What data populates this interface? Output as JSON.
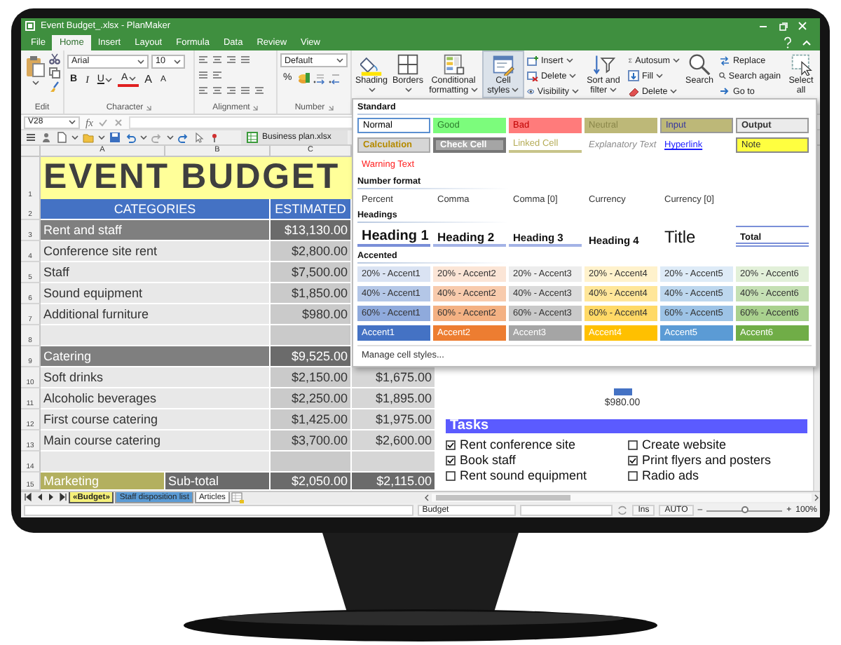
{
  "window": {
    "title": "Event Budget_.xlsx - PlanMaker"
  },
  "menu_tabs": [
    {
      "label": "File",
      "selected": false
    },
    {
      "label": "Home",
      "selected": true
    },
    {
      "label": "Insert",
      "selected": false
    },
    {
      "label": "Layout",
      "selected": false
    },
    {
      "label": "Formula",
      "selected": false
    },
    {
      "label": "Data",
      "selected": false
    },
    {
      "label": "Review",
      "selected": false
    },
    {
      "label": "View",
      "selected": false
    }
  ],
  "ribbon": {
    "font_name": "Arial",
    "font_size": "10",
    "char_buttons": [
      "B",
      "I",
      "U",
      "A",
      "A",
      "A"
    ],
    "number_format": "Default",
    "number_buttons": [
      "%"
    ],
    "group_labels": [
      "Edit",
      "Character",
      "Alignment",
      "Number"
    ],
    "tools": [
      {
        "kind": "large",
        "label": "Shading",
        "selected": false,
        "caret": true
      },
      {
        "kind": "large",
        "label": "Borders",
        "selected": false,
        "caret": true
      },
      {
        "kind": "large",
        "label": "Conditional formatting",
        "selected": false,
        "caret": true
      },
      {
        "kind": "large",
        "label": "Cell styles",
        "selected": true,
        "caret": true
      },
      {
        "kind": "stack",
        "items": [
          {
            "label": "Insert",
            "caret": true
          },
          {
            "label": "Delete",
            "caret": true
          },
          {
            "label": "Visibility",
            "caret": true
          }
        ]
      },
      {
        "kind": "large",
        "label": "Sort and filter",
        "selected": false,
        "caret": true
      },
      {
        "kind": "stack",
        "items": [
          {
            "label": "Autosum",
            "caret": true
          },
          {
            "label": "Fill",
            "caret": true
          },
          {
            "label": "Delete",
            "caret": true
          }
        ]
      },
      {
        "kind": "large",
        "label": "Search",
        "selected": false,
        "caret": false
      },
      {
        "kind": "stack",
        "items": [
          {
            "label": "Replace",
            "caret": false
          },
          {
            "label": "Search again",
            "caret": false
          },
          {
            "label": "Go to",
            "caret": false
          }
        ]
      },
      {
        "kind": "large",
        "label": "Select all",
        "selected": false,
        "caret": false
      }
    ]
  },
  "formula_bar": {
    "cell_ref": "V28",
    "function_label": "fx"
  },
  "document_tab": {
    "label": "Business plan.xlsx"
  },
  "columns": [
    "A",
    "B",
    "C"
  ],
  "rows": [
    {
      "number": "1",
      "kind": "title",
      "cells": [
        "EVENT BUDGET"
      ]
    },
    {
      "number": "2",
      "kind": "header",
      "cells": [
        "CATEGORIES",
        "ESTIMATED"
      ]
    },
    {
      "number": "3",
      "kind": "section",
      "cells": [
        "Rent and staff",
        "$13,130.00"
      ]
    },
    {
      "number": "4",
      "kind": "item",
      "cells": [
        "Conference site rent",
        "$2,800.00"
      ]
    },
    {
      "number": "5",
      "kind": "item",
      "cells": [
        "Staff",
        "$7,500.00"
      ]
    },
    {
      "number": "6",
      "kind": "item",
      "cells": [
        "Sound equipment",
        "$1,850.00"
      ]
    },
    {
      "number": "7",
      "kind": "item",
      "cells": [
        "Additional furniture",
        "$980.00"
      ]
    },
    {
      "number": "8",
      "kind": "blank",
      "cells": []
    },
    {
      "number": "9",
      "kind": "section",
      "cells": [
        "Catering",
        "$9,525.00"
      ]
    },
    {
      "number": "10",
      "kind": "item",
      "cells": [
        "Soft drinks",
        "$2,150.00",
        "$1,675.00"
      ]
    },
    {
      "number": "11",
      "kind": "item",
      "cells": [
        "Alcoholic beverages",
        "$2,250.00",
        "$1,895.00"
      ]
    },
    {
      "number": "12",
      "kind": "item",
      "cells": [
        "First course catering",
        "$1,425.00",
        "$1,975.00"
      ]
    },
    {
      "number": "13",
      "kind": "item",
      "cells": [
        "Main course catering",
        "$3,700.00",
        "$2,600.00"
      ]
    },
    {
      "number": "14",
      "kind": "blank",
      "cells": []
    },
    {
      "number": "15",
      "kind": "subtotal",
      "cells": [
        "Marketing",
        "Sub-total",
        "$2,050.00",
        "$2,115.00"
      ]
    }
  ],
  "styles_menu": {
    "sections": [
      {
        "label": "Standard",
        "items": [
          {
            "label": "Normal",
            "kind": "normal"
          },
          {
            "label": "Good",
            "kind": "good"
          },
          {
            "label": "Bad",
            "kind": "bad"
          },
          {
            "label": "Neutral",
            "kind": "neutral"
          },
          {
            "label": "Input",
            "kind": "input"
          },
          {
            "label": "Output",
            "kind": "output"
          },
          {
            "label": "Calculation",
            "kind": "calculation"
          },
          {
            "label": "Check Cell",
            "kind": "check"
          },
          {
            "label": "Linked Cell",
            "kind": "linked"
          },
          {
            "label": "Explanatory Text",
            "kind": "explanatory"
          },
          {
            "label": "Hyperlink",
            "kind": "hyperlink"
          },
          {
            "label": "Note",
            "kind": "note"
          },
          {
            "label": "Warning Text",
            "kind": "warning"
          }
        ]
      },
      {
        "label": "Number format",
        "items": [
          {
            "label": "Percent",
            "kind": "plain"
          },
          {
            "label": "Comma",
            "kind": "plain"
          },
          {
            "label": "Comma [0]",
            "kind": "plain"
          },
          {
            "label": "Currency",
            "kind": "plain"
          },
          {
            "label": "Currency [0]",
            "kind": "plain"
          }
        ]
      },
      {
        "label": "Headings",
        "items": [
          {
            "label": "Heading 1",
            "kind": "heading1"
          },
          {
            "label": "Heading 2",
            "kind": "heading2"
          },
          {
            "label": "Heading 3",
            "kind": "heading3"
          },
          {
            "label": "Heading 4",
            "kind": "heading4"
          },
          {
            "label": "Title",
            "kind": "title"
          },
          {
            "label": "Total",
            "kind": "total"
          }
        ]
      },
      {
        "label": "Accented",
        "items": [
          {
            "label": "20% - Accent1",
            "kind": "tint",
            "color": "#dae3f3"
          },
          {
            "label": "20% - Accent2",
            "kind": "tint",
            "color": "#fbe5d6"
          },
          {
            "label": "20% - Accent3",
            "kind": "tint",
            "color": "#ededed"
          },
          {
            "label": "20% - Accent4",
            "kind": "tint",
            "color": "#fff2cc"
          },
          {
            "label": "20% - Accent5",
            "kind": "tint",
            "color": "#deebf7"
          },
          {
            "label": "20% - Accent6",
            "kind": "tint",
            "color": "#e2f0d9"
          },
          {
            "label": "40% - Accent1",
            "kind": "tint",
            "color": "#b4c7e7"
          },
          {
            "label": "40% - Accent2",
            "kind": "tint",
            "color": "#f8cbad"
          },
          {
            "label": "40% - Accent3",
            "kind": "tint",
            "color": "#dbdbdb"
          },
          {
            "label": "40% - Accent4",
            "kind": "tint",
            "color": "#ffe699"
          },
          {
            "label": "40% - Accent5",
            "kind": "tint",
            "color": "#bdd7ee"
          },
          {
            "label": "40% - Accent6",
            "kind": "tint",
            "color": "#c5e0b4"
          },
          {
            "label": "60% - Accent1",
            "kind": "tint",
            "color": "#8faadc"
          },
          {
            "label": "60% - Accent2",
            "kind": "tint",
            "color": "#f4b183"
          },
          {
            "label": "60% - Accent3",
            "kind": "tint",
            "color": "#c9c9c9"
          },
          {
            "label": "60% - Accent4",
            "kind": "tint",
            "color": "#ffd966"
          },
          {
            "label": "60% - Accent5",
            "kind": "tint",
            "color": "#9dc3e6"
          },
          {
            "label": "60% - Accent6",
            "kind": "tint",
            "color": "#a9d18e"
          },
          {
            "label": "Accent1",
            "kind": "solid",
            "color": "#4472c4"
          },
          {
            "label": "Accent2",
            "kind": "solid",
            "color": "#ed7d31"
          },
          {
            "label": "Accent3",
            "kind": "solid",
            "color": "#a5a5a5"
          },
          {
            "label": "Accent4",
            "kind": "solid",
            "color": "#ffc000"
          },
          {
            "label": "Accent5",
            "kind": "solid",
            "color": "#5b9bd5"
          },
          {
            "label": "Accent6",
            "kind": "solid",
            "color": "#70ad47"
          }
        ]
      }
    ],
    "footer": "Manage cell styles..."
  },
  "chart_fragment": {
    "label": "$980.00"
  },
  "tasks": {
    "title": "Tasks",
    "items": [
      {
        "label": "Rent conference site",
        "checked": true
      },
      {
        "label": "Create website",
        "checked": false
      },
      {
        "label": "Book staff",
        "checked": true
      },
      {
        "label": "Print flyers and posters",
        "checked": true
      },
      {
        "label": "Rent sound equipment",
        "checked": false
      },
      {
        "label": "Radio ads",
        "checked": false
      }
    ]
  },
  "sheet_tabs": [
    {
      "label": "«Budget»",
      "selected": true,
      "color": "#f5f07a"
    },
    {
      "label": "Staff disposition list",
      "selected": false,
      "color": "#5b9bd5"
    },
    {
      "label": "Articles",
      "selected": false,
      "color": "#ffffff"
    }
  ],
  "status_bar": {
    "sheet_name": "Budget",
    "mode": "Ins",
    "calc": "AUTO",
    "zoom_out": "–",
    "zoom_in": "+",
    "zoom": {
      "level": 0.5
    },
    "zoom_label": "100%"
  }
}
